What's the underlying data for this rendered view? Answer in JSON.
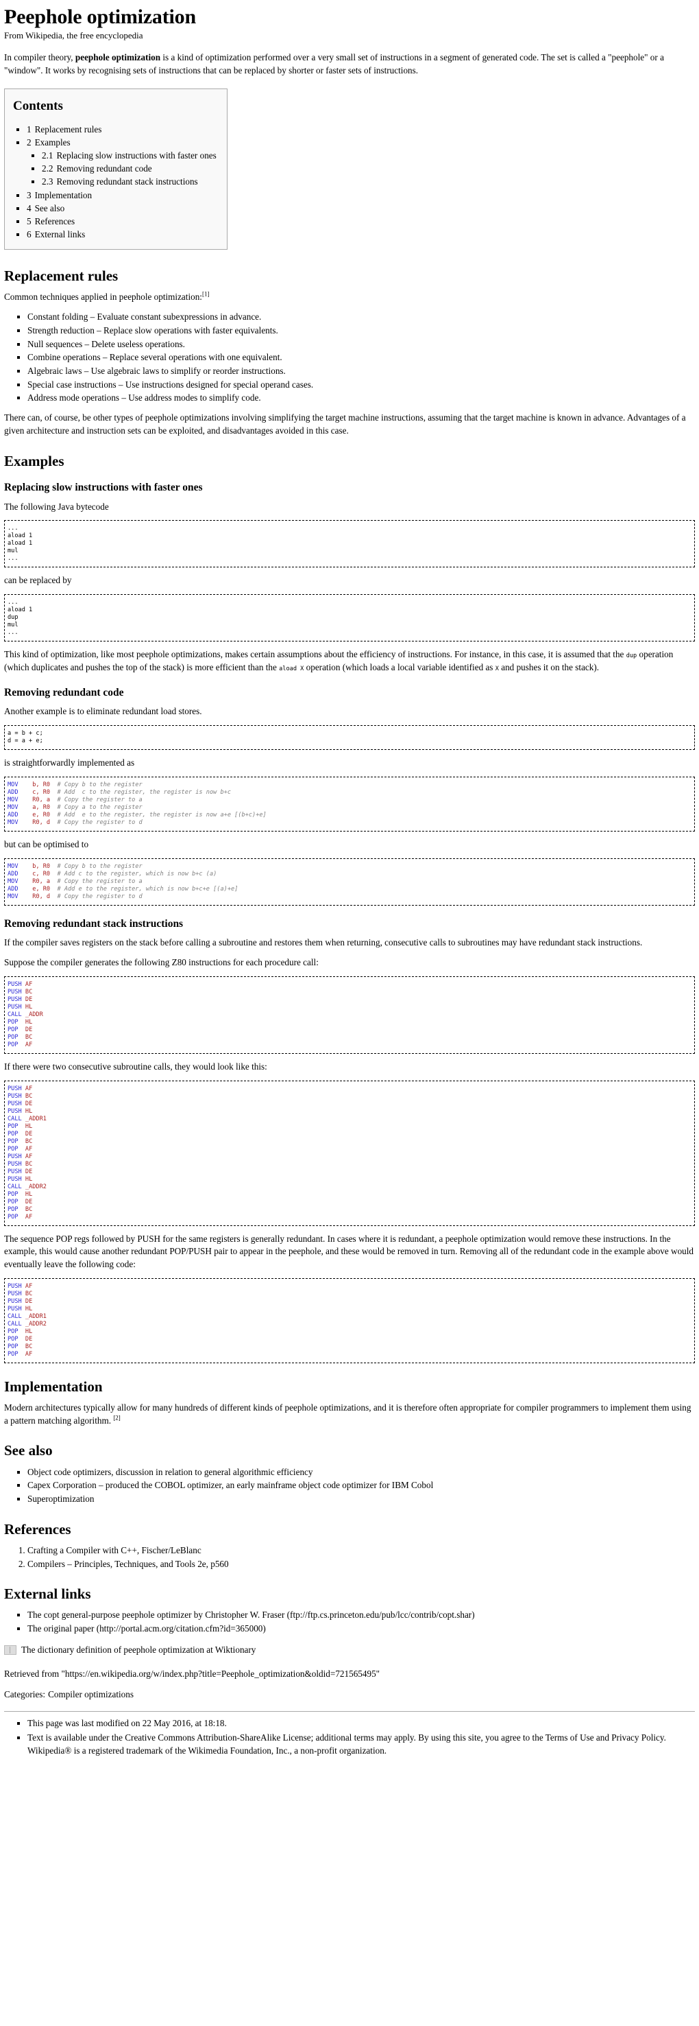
{
  "article": {
    "title": "Peephole optimization",
    "tagline": "From Wikipedia, the free encyclopedia",
    "intro": "In compiler theory, peephole optimization is a kind of optimization performed over a very small set of instructions in a segment of generated code. The set is called a \"peephole\" or a \"window\". It works by recognising sets of instructions that can be replaced by shorter or faster sets of instructions.",
    "intro_bold_term": "peephole optimization"
  },
  "toc": {
    "heading": "Contents",
    "items": [
      {
        "number": "1",
        "label": "Replacement rules"
      },
      {
        "number": "2",
        "label": "Examples",
        "children": [
          {
            "number": "2.1",
            "label": "Replacing slow instructions with faster ones"
          },
          {
            "number": "2.2",
            "label": "Removing redundant code"
          },
          {
            "number": "2.3",
            "label": "Removing redundant stack instructions"
          }
        ]
      },
      {
        "number": "3",
        "label": "Implementation"
      },
      {
        "number": "4",
        "label": "See also"
      },
      {
        "number": "5",
        "label": "References"
      },
      {
        "number": "6",
        "label": "External links"
      }
    ]
  },
  "replacement_rules": {
    "heading": "Replacement rules",
    "lead": "Common techniques applied in peephole optimization:",
    "lead_ref": "[1]",
    "bullets": [
      "Constant folding – Evaluate constant subexpressions in advance.",
      "Strength reduction – Replace slow operations with faster equivalents.",
      "Null sequences – Delete useless operations.",
      "Combine operations – Replace several operations with one equivalent.",
      "Algebraic laws – Use algebraic laws to simplify or reorder instructions.",
      "Special case instructions – Use instructions designed for special operand cases.",
      "Address mode operations – Use address modes to simplify code."
    ],
    "closing": "There can, of course, be other types of peephole optimizations involving simplifying the target machine instructions, assuming that the target machine is known in advance. Advantages of a given architecture and instruction sets can be exploited, and disadvantages avoided in this case."
  },
  "examples": {
    "heading": "Examples",
    "slow_instructions": {
      "heading": "Replacing slow instructions with faster ones",
      "intro": "The following Java bytecode",
      "code_before": "...\naload 1\naload 1\nmul\n...",
      "middle": "can be replaced by",
      "code_after": "...\naload 1\ndup\nmul\n...",
      "closing_1": "This kind of optimization, like most peephole optimizations, makes certain assumptions about the efficiency of instructions. For instance, in this case, it is assumed that the ",
      "closing_code_1": "dup",
      "closing_2": " operation (which duplicates and pushes the top of the stack) is more efficient than the ",
      "closing_code_2": "aload X",
      "closing_3": " operation (which loads a local variable identified as ",
      "closing_code_3": "X",
      "closing_4": " and pushes it on the stack)."
    },
    "redundant_code": {
      "heading": "Removing redundant code",
      "intro": "Another example is to eliminate redundant load stores.",
      "code_source": "a = b + c;\nd = a + e;",
      "middle": "is straightforwardly implemented as",
      "asm_before": [
        {
          "op": "MOV",
          "args": "b, R0",
          "comment": "# Copy b to the register"
        },
        {
          "op": "ADD",
          "args": "c, R0",
          "comment": "# Add  c to the register, the register is now b+c"
        },
        {
          "op": "MOV",
          "args": "R0, a",
          "comment": "# Copy the register to a"
        },
        {
          "op": "MOV",
          "args": "a, R0",
          "comment": "# Copy a to the register"
        },
        {
          "op": "ADD",
          "args": "e, R0",
          "comment": "# Add  e to the register, the register is now a+e [(b+c)+e]"
        },
        {
          "op": "MOV",
          "args": "R0, d",
          "comment": "# Copy the register to d"
        }
      ],
      "middle2": "but can be optimised to",
      "asm_after": [
        {
          "op": "MOV",
          "args": "b, R0",
          "comment": "# Copy b to the register"
        },
        {
          "op": "ADD",
          "args": "c, R0",
          "comment": "# Add c to the register, which is now b+c (a)"
        },
        {
          "op": "MOV",
          "args": "R0, a",
          "comment": "# Copy the register to a"
        },
        {
          "op": "ADD",
          "args": "e, R0",
          "comment": "# Add e to the register, which is now b+c+e [(a)+e]"
        },
        {
          "op": "MOV",
          "args": "R0, d",
          "comment": "# Copy the register to d"
        }
      ]
    },
    "stack_instructions": {
      "heading": "Removing redundant stack instructions",
      "intro": "If the compiler saves registers on the stack before calling a subroutine and restores them when returning, consecutive calls to subroutines may have redundant stack instructions.",
      "suppose": "Suppose the compiler generates the following Z80 instructions for each procedure call:",
      "z80_single": [
        {
          "op": "PUSH",
          "args": "AF"
        },
        {
          "op": "PUSH",
          "args": "BC"
        },
        {
          "op": "PUSH",
          "args": "DE"
        },
        {
          "op": "PUSH",
          "args": "HL"
        },
        {
          "op": "CALL",
          "args": "_ADDR"
        },
        {
          "op": "POP",
          "args": "HL"
        },
        {
          "op": "POP",
          "args": "DE"
        },
        {
          "op": "POP",
          "args": "BC"
        },
        {
          "op": "POP",
          "args": "AF"
        }
      ],
      "middle": "If there were two consecutive subroutine calls, they would look like this:",
      "z80_double": [
        {
          "op": "PUSH",
          "args": "AF"
        },
        {
          "op": "PUSH",
          "args": "BC"
        },
        {
          "op": "PUSH",
          "args": "DE"
        },
        {
          "op": "PUSH",
          "args": "HL"
        },
        {
          "op": "CALL",
          "args": "_ADDR1"
        },
        {
          "op": "POP",
          "args": "HL"
        },
        {
          "op": "POP",
          "args": "DE"
        },
        {
          "op": "POP",
          "args": "BC"
        },
        {
          "op": "POP",
          "args": "AF"
        },
        {
          "op": "PUSH",
          "args": "AF"
        },
        {
          "op": "PUSH",
          "args": "BC"
        },
        {
          "op": "PUSH",
          "args": "DE"
        },
        {
          "op": "PUSH",
          "args": "HL"
        },
        {
          "op": "CALL",
          "args": "_ADDR2"
        },
        {
          "op": "POP",
          "args": "HL"
        },
        {
          "op": "POP",
          "args": "DE"
        },
        {
          "op": "POP",
          "args": "BC"
        },
        {
          "op": "POP",
          "args": "AF"
        }
      ],
      "closing": "The sequence POP regs followed by PUSH for the same registers is generally redundant. In cases where it is redundant, a peephole optimization would remove these instructions. In the example, this would cause another redundant POP/PUSH pair to appear in the peephole, and these would be removed in turn. Removing all of the redundant code in the example above would eventually leave the following code:",
      "z80_optimised": [
        {
          "op": "PUSH",
          "args": "AF"
        },
        {
          "op": "PUSH",
          "args": "BC"
        },
        {
          "op": "PUSH",
          "args": "DE"
        },
        {
          "op": "PUSH",
          "args": "HL"
        },
        {
          "op": "CALL",
          "args": "_ADDR1"
        },
        {
          "op": "CALL",
          "args": "_ADDR2"
        },
        {
          "op": "POP",
          "args": "HL"
        },
        {
          "op": "POP",
          "args": "DE"
        },
        {
          "op": "POP",
          "args": "BC"
        },
        {
          "op": "POP",
          "args": "AF"
        }
      ]
    }
  },
  "implementation": {
    "heading": "Implementation",
    "text": "Modern architectures typically allow for many hundreds of different kinds of peephole optimizations, and it is therefore often appropriate for compiler programmers to implement them using a pattern matching algorithm.",
    "ref": "[2]"
  },
  "see_also": {
    "heading": "See also",
    "items": [
      "Object code optimizers, discussion in relation to general algorithmic efficiency",
      "Capex Corporation – produced the COBOL optimizer, an early mainframe object code optimizer for IBM Cobol",
      "Superoptimization"
    ]
  },
  "references": {
    "heading": "References",
    "items": [
      "Crafting a Compiler with C++, Fischer/LeBlanc",
      "Compilers – Principles, Techniques, and Tools 2e, p560"
    ]
  },
  "external_links": {
    "heading": "External links",
    "items": [
      "The copt general-purpose peephole optimizer by Christopher W. Fraser (ftp://ftp.cs.princeton.edu/pub/lcc/contrib/copt.shar)",
      "The original paper (http://portal.acm.org/citation.cfm?id=365000)"
    ],
    "wiktionary": "The dictionary definition of peephole optimization at Wiktionary"
  },
  "footer": {
    "retrieved": "Retrieved from \"https://en.wikipedia.org/w/index.php?title=Peephole_optimization&oldid=721565495\"",
    "categories_label": "Categories:",
    "categories": "Compiler optimizations",
    "notes": [
      "This page was last modified on 22 May 2016, at 18:18.",
      "Text is available under the Creative Commons Attribution-ShareAlike License; additional terms may apply. By using this site, you agree to the Terms of Use and Privacy Policy. Wikipedia® is a registered trademark of the Wikimedia Foundation, Inc., a non-profit organization."
    ]
  }
}
